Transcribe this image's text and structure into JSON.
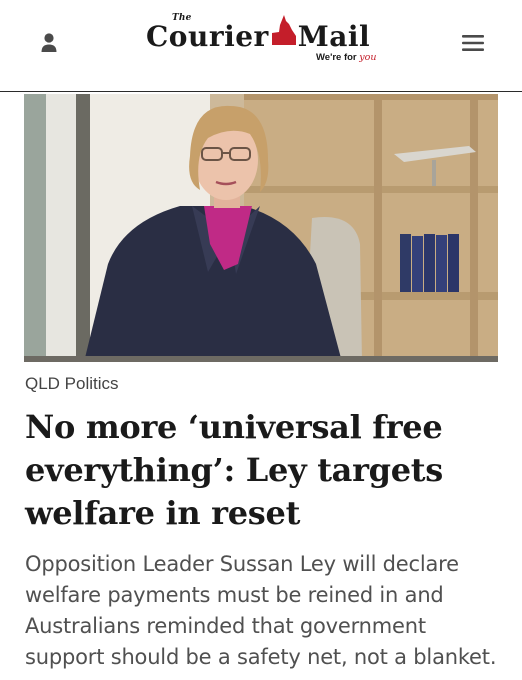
{
  "header": {
    "account_icon": "person-icon",
    "menu_icon": "hamburger-menu-icon",
    "logo": {
      "the": "The",
      "word1": "Courier",
      "word2": "Mail",
      "tagline_prefix": "We're for ",
      "tagline_script": "you",
      "emblem_icon": "queensland-map-icon"
    }
  },
  "article": {
    "category": "QLD Politics",
    "headline": "No more ‘universal free everything’: Ley targets welfare in reset",
    "standfirst": "Opposition Leader Sussan Ley will declare welfare payments must be reined in and Australians reminded that government support should be a safety net, not a blanket."
  },
  "colors": {
    "brand_red": "#c41e2a",
    "text_dark": "#1a1a1a",
    "text_muted": "#505050",
    "divider": "#2b2b2b"
  }
}
